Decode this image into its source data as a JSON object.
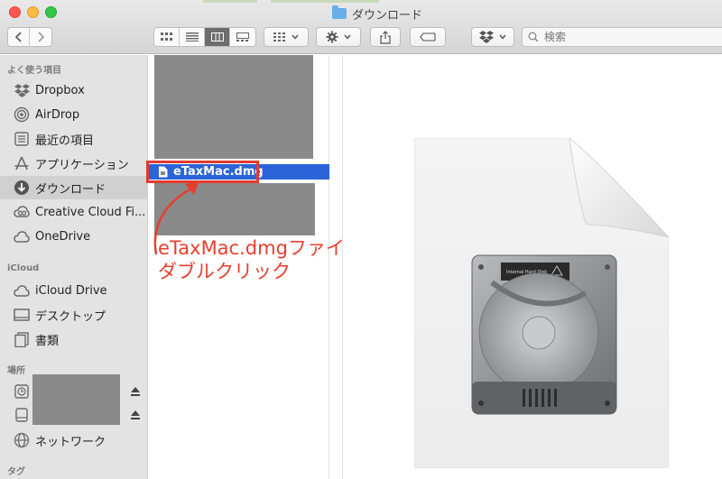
{
  "window": {
    "title": "ダウンロード"
  },
  "toolbar": {
    "search_placeholder": "検索"
  },
  "sidebar": {
    "favorites_header": "よく使う項目",
    "favorites": [
      {
        "label": "Dropbox",
        "icon": "dropbox-icon"
      },
      {
        "label": "AirDrop",
        "icon": "airdrop-icon"
      },
      {
        "label": "最近の項目",
        "icon": "recents-icon"
      },
      {
        "label": "アプリケーション",
        "icon": "applications-icon"
      },
      {
        "label": "ダウンロード",
        "icon": "downloads-icon",
        "selected": true
      },
      {
        "label": "Creative Cloud Fi...",
        "icon": "creative-cloud-icon"
      },
      {
        "label": "OneDrive",
        "icon": "cloud-icon"
      }
    ],
    "icloud_header": "iCloud",
    "icloud": [
      {
        "label": "iCloud Drive",
        "icon": "cloud-icon"
      },
      {
        "label": "デスクトップ",
        "icon": "desktop-icon"
      },
      {
        "label": "書類",
        "icon": "documents-icon"
      }
    ],
    "locations_header": "場所",
    "locations": [
      {
        "label": "ネットワーク",
        "icon": "network-icon"
      }
    ],
    "tags_header": "タグ"
  },
  "file_list": {
    "selected_file": "eTaxMac.dmg"
  },
  "annotation": {
    "line1": "eTaxMac.dmgファイルを",
    "line2": "ダブルクリック",
    "color": "#e5402f"
  },
  "preview": {
    "disk_label": "Internal Hard Disk"
  }
}
